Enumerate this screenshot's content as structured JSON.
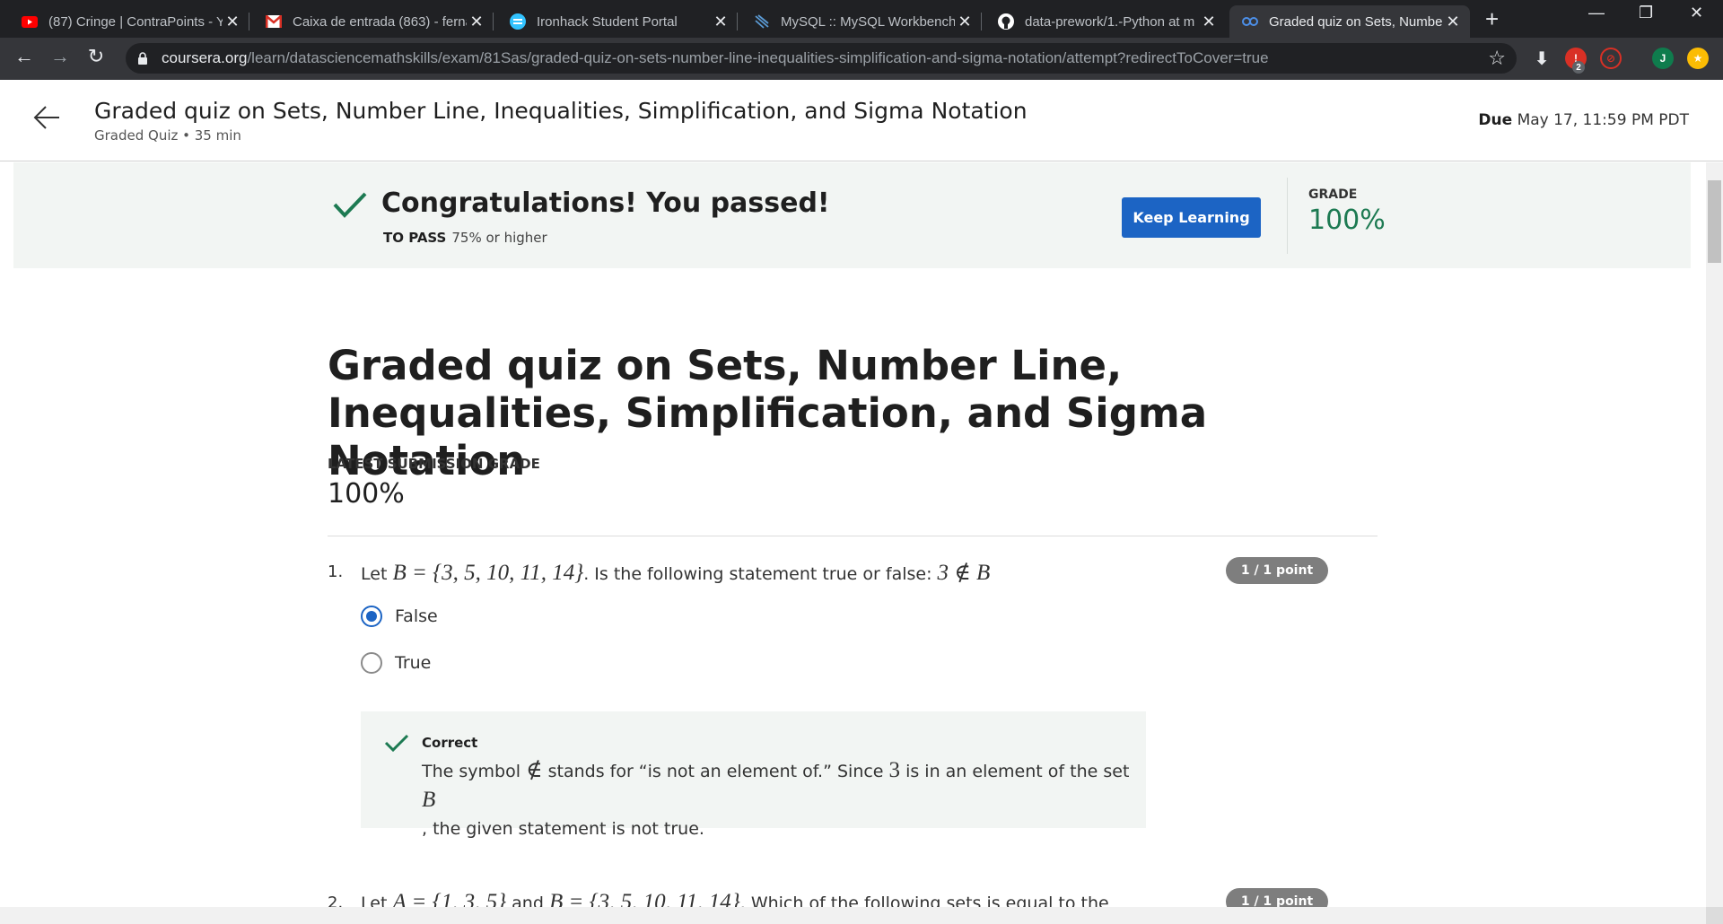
{
  "browser": {
    "tabs": [
      {
        "title": "(87) Cringe | ContraPoints - Y",
        "icon": "youtube-icon"
      },
      {
        "title": "Caixa de entrada (863) - ferna",
        "icon": "gmail-icon"
      },
      {
        "title": "Ironhack Student Portal",
        "icon": "ironhack-icon"
      },
      {
        "title": "MySQL :: MySQL Workbench",
        "icon": "mysql-icon"
      },
      {
        "title": "data-prework/1.-Python at m",
        "icon": "github-icon"
      },
      {
        "title": "Graded quiz on Sets, Numbe",
        "icon": "coursera-icon",
        "active": true
      }
    ],
    "url_host": "coursera.org",
    "url_path": "/learn/datasciencemathskills/exam/81Sas/graded-quiz-on-sets-number-line-inequalities-simplification-and-sigma-notation/attempt?redirectToCover=true",
    "extension_badge": "2",
    "profile_initial": "J"
  },
  "header": {
    "title": "Graded quiz on Sets, Number Line, Inequalities, Simplification, and Sigma Notation",
    "subtitle": "Graded Quiz • 35 min",
    "due_label": "Due",
    "due_value": "May 17, 11:59 PM PDT"
  },
  "banner": {
    "title": "Congratulations! You passed!",
    "to_pass_label": "TO PASS",
    "to_pass_value": "75% or higher",
    "button_label": "Keep Learning",
    "grade_label": "GRADE",
    "grade_value": "100%"
  },
  "quiz": {
    "title": "Graded quiz on Sets, Number Line, Inequalities, Simplification, and Sigma Notation",
    "latest_label": "LATEST SUBMISSION GRADE",
    "latest_value": "100%"
  },
  "questions": [
    {
      "number": "1.",
      "prefix": "Let ",
      "math1": "B = {3, 5, 10, 11, 14}",
      "middle": ". Is the following statement true or false: ",
      "math2": "3 ∉ B",
      "points": "1 / 1 point",
      "options": [
        {
          "label": "False",
          "selected": true
        },
        {
          "label": "True",
          "selected": false
        }
      ],
      "feedback": {
        "title": "Correct",
        "p1": "The symbol ",
        "sym": "∉",
        "p2": " stands for “is not an element of.” Since ",
        "n": "3",
        "p3": " is in an element of the set ",
        "set": "B",
        "p4": ", the given statement is not true."
      }
    },
    {
      "number": "2.",
      "prefix": "Let ",
      "math1": "A = {1, 3, 5}",
      "middle": " and ",
      "math2": "B = {3, 5, 10, 11, 14}",
      "suffix": ". Which of the following sets is equal to the",
      "points": "1 / 1 point"
    }
  ],
  "colors": {
    "accent": "#1c64c4",
    "success": "#1d7a52",
    "banner_bg": "#f2f5f3"
  }
}
